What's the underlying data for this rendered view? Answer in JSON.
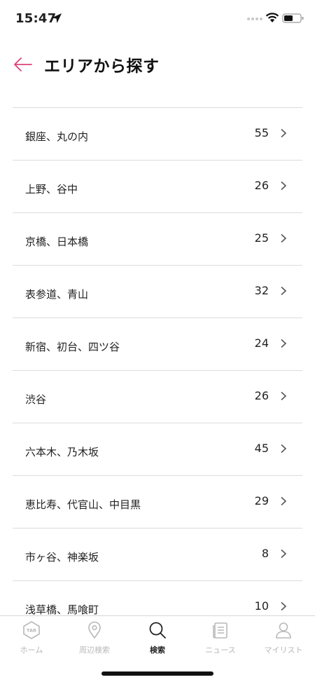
{
  "status_bar": {
    "time": "15:47"
  },
  "header": {
    "title": "エリアから探す"
  },
  "areas": [
    {
      "name": "銀座、丸の内",
      "count": "55"
    },
    {
      "name": "上野、谷中",
      "count": "26"
    },
    {
      "name": "京橋、日本橋",
      "count": "25"
    },
    {
      "name": "表参道、青山",
      "count": "32"
    },
    {
      "name": "新宿、初台、四ツ谷",
      "count": "24"
    },
    {
      "name": "渋谷",
      "count": "26"
    },
    {
      "name": "六本木、乃木坂",
      "count": "45"
    },
    {
      "name": "恵比寿、代官山、中目黒",
      "count": "29"
    },
    {
      "name": "市ヶ谷、神楽坂",
      "count": "8"
    },
    {
      "name": "浅草橋、馬喰町",
      "count": "10"
    }
  ],
  "tab_bar": {
    "tabs": [
      {
        "label": "ホーム",
        "icon": "tab-home-icon",
        "badge": "TAB"
      },
      {
        "label": "周辺検索",
        "icon": "map-pin-icon"
      },
      {
        "label": "検索",
        "icon": "search-icon",
        "active": true
      },
      {
        "label": "ニュース",
        "icon": "news-icon"
      },
      {
        "label": "マイリスト",
        "icon": "user-icon"
      }
    ]
  },
  "colors": {
    "accent": "#e0407a",
    "active_tab": "#222222",
    "inactive_tab": "#b8b8b8",
    "divider": "#dcdcdc"
  }
}
